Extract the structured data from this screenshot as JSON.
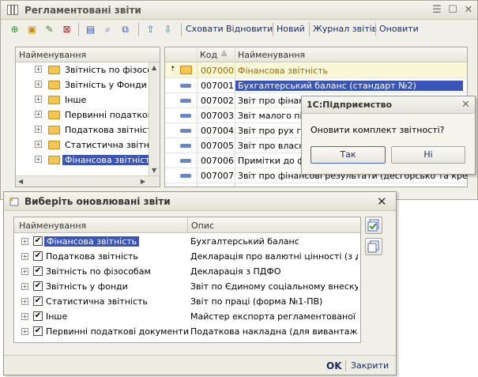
{
  "main": {
    "title": "Регламентовані звіти",
    "toolbar": {
      "hide": "Сховати",
      "restore": "Відновити",
      "new": "Новий",
      "journal": "Журнал звітів",
      "update": "Оновити"
    },
    "tree": {
      "header": "Найменування",
      "items": [
        {
          "label": "Звітність по фізособ"
        },
        {
          "label": "Звітність у Фонди"
        },
        {
          "label": "Інше"
        },
        {
          "label": "Первинні податкові д"
        },
        {
          "label": "Податкова звітність"
        },
        {
          "label": "Статистична звітніст"
        },
        {
          "label": "Фінансова звітніст"
        }
      ]
    },
    "table": {
      "col_code": "Код",
      "col_name": "Найменування",
      "rows": [
        {
          "code": "007000",
          "name": "Фінансова звітність"
        },
        {
          "code": "007001",
          "name": "Бухгалтерський баланс (стандарт №2)"
        },
        {
          "code": "007002",
          "name": "Звіт про фінансо"
        },
        {
          "code": "007003",
          "name": "Звіт малого підп"
        },
        {
          "code": "007004",
          "name": "Звіт про рух грош"
        },
        {
          "code": "007005",
          "name": "Звіт про власни"
        },
        {
          "code": "007006",
          "name": "Примітки до фін"
        },
        {
          "code": "007007",
          "name": "Звіт про фінансові результати (десгорсько та кред..."
        }
      ]
    }
  },
  "dialog_1c": {
    "title": "1С:Підприємство",
    "message": "Оновити комплект звітності?",
    "yes": "Так",
    "no": "Ні"
  },
  "update_dialog": {
    "title": "Виберіть оновлювані звіти",
    "col_name": "Найменування",
    "col_desc": "Опис",
    "rows": [
      {
        "name": "Фінансова звітність",
        "desc": "Бухгалтерський баланс",
        "checked": "✔"
      },
      {
        "name": "Податкова звітність",
        "desc": "Декларація про валютні цінності (з довід...",
        "checked": "✔"
      },
      {
        "name": "Звітність по фізособам",
        "desc": "Декларація з ПДФО",
        "checked": "✔"
      },
      {
        "name": "Звітність у фонди",
        "desc": "Звіт по Єдиному соціальному внеску",
        "checked": "✔"
      },
      {
        "name": "Статистична звітність",
        "desc": "Звіт по праці (форма №1-ПВ)",
        "checked": "✔"
      },
      {
        "name": "Інше",
        "desc": "Майстер експорта регламентованої зві...",
        "checked": "✔"
      },
      {
        "name": "Первинні податкові документи",
        "desc": "Податкова накладна (для вивантаженн...",
        "checked": "✔"
      }
    ],
    "ok": "OK",
    "close": "Закрити"
  }
}
